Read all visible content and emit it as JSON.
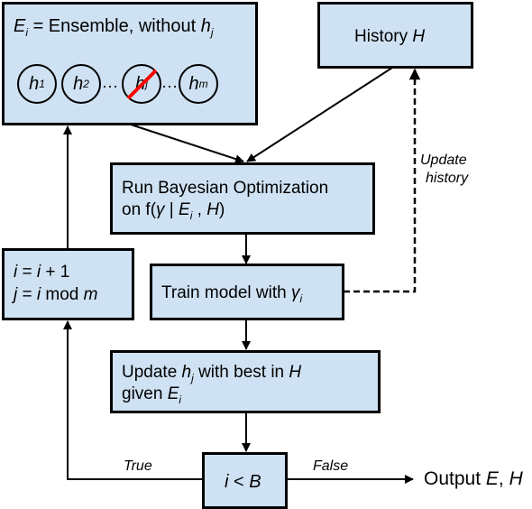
{
  "ensemble": {
    "symbol": "E",
    "symbol_sub": "i",
    "equals": " = Ensemble, without ",
    "excluded": "h",
    "excluded_sub": "j",
    "members": [
      {
        "label": "h",
        "sub": "1",
        "removed": false
      },
      {
        "label": "h",
        "sub": "2",
        "removed": false
      },
      {
        "label": "h",
        "sub": "j",
        "removed": true
      },
      {
        "label": "h",
        "sub": "m",
        "removed": false
      }
    ],
    "ellipsis": "···",
    "strike_color": "#ff0000"
  },
  "history": {
    "text": "History ",
    "symbol": "H"
  },
  "bayes_opt": {
    "line1": "Run Bayesian Optimization",
    "line2_prefix": "on f(",
    "gamma": "γ",
    "bar": " | ",
    "E": "E",
    "E_sub": "i",
    "comma": " , ",
    "H": "H",
    "close": ")"
  },
  "train": {
    "text": "Train model with ",
    "gamma": "γ",
    "gamma_sub": "i"
  },
  "increment": {
    "line1_a": "i",
    "line1_b": " = ",
    "line1_c": "i",
    "line1_d": " + 1",
    "line2_a": "j",
    "line2_b": " = ",
    "line2_c": "i",
    "line2_d": " mod ",
    "line2_e": "m"
  },
  "update": {
    "line1_a": "Update ",
    "h": "h",
    "h_sub": "j",
    "line1_b": " with best in ",
    "H": "H",
    "line2_a": "given ",
    "E": "E",
    "E_sub": "i"
  },
  "condition": {
    "i": "i",
    "op": " < ",
    "B": "B"
  },
  "edge_labels": {
    "update_history_1": "Update",
    "update_history_2": "history",
    "true": "True",
    "false": "False"
  },
  "output": {
    "text": "Output ",
    "E": "E",
    "sep": ", ",
    "H": "H"
  },
  "colors": {
    "box_fill": "#cfe2f3",
    "stroke": "#000000",
    "strike": "#ff0000"
  }
}
